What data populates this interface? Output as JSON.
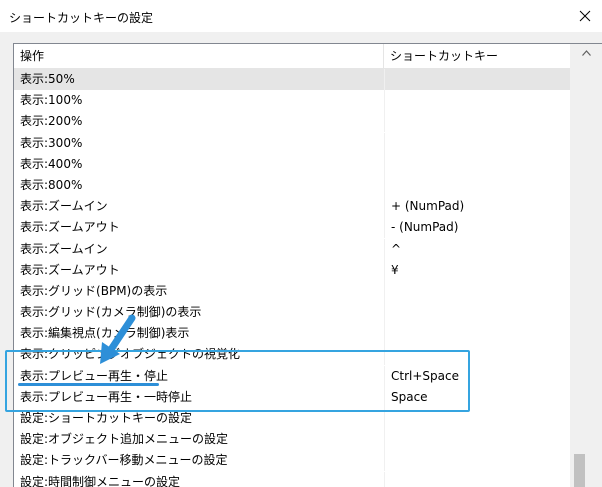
{
  "window": {
    "title": "ショートカットキーの設定",
    "close_icon": "close-icon"
  },
  "list": {
    "columns": [
      "操作",
      "ショートカットキー"
    ],
    "selected_index": 0,
    "rows": [
      {
        "action": "表示:50%",
        "shortcut": ""
      },
      {
        "action": "表示:100%",
        "shortcut": ""
      },
      {
        "action": "表示:200%",
        "shortcut": ""
      },
      {
        "action": "表示:300%",
        "shortcut": ""
      },
      {
        "action": "表示:400%",
        "shortcut": ""
      },
      {
        "action": "表示:800%",
        "shortcut": ""
      },
      {
        "action": "表示:ズームイン",
        "shortcut": "+ (NumPad)"
      },
      {
        "action": "表示:ズームアウト",
        "shortcut": "- (NumPad)"
      },
      {
        "action": "表示:ズームイン",
        "shortcut": "^"
      },
      {
        "action": "表示:ズームアウト",
        "shortcut": "¥"
      },
      {
        "action": "表示:グリッド(BPM)の表示",
        "shortcut": ""
      },
      {
        "action": "表示:グリッド(カメラ制御)の表示",
        "shortcut": ""
      },
      {
        "action": "表示:編集視点(カメラ制御)表示",
        "shortcut": ""
      },
      {
        "action": "表示:クリッピングオブジェクトの視覚化",
        "shortcut": ""
      },
      {
        "action": "表示:プレビュー再生・停止",
        "shortcut": "Ctrl+Space"
      },
      {
        "action": "表示:プレビュー再生・一時停止",
        "shortcut": "Space"
      },
      {
        "action": "設定:ショートカットキーの設定",
        "shortcut": ""
      },
      {
        "action": "設定:オブジェクト追加メニューの設定",
        "shortcut": ""
      },
      {
        "action": "設定:トラックバー移動メニューの設定",
        "shortcut": ""
      },
      {
        "action": "設定:時間制御メニューの設定",
        "shortcut": ""
      }
    ]
  },
  "annotation": {
    "color": "#35a4e0",
    "arrow_icon": "arrow-down-left-icon"
  },
  "colors": {
    "selected_row": "#e5e5e5",
    "scrollbar_track": "#f0f0f0",
    "scrollbar_thumb": "#c1c1c1"
  }
}
